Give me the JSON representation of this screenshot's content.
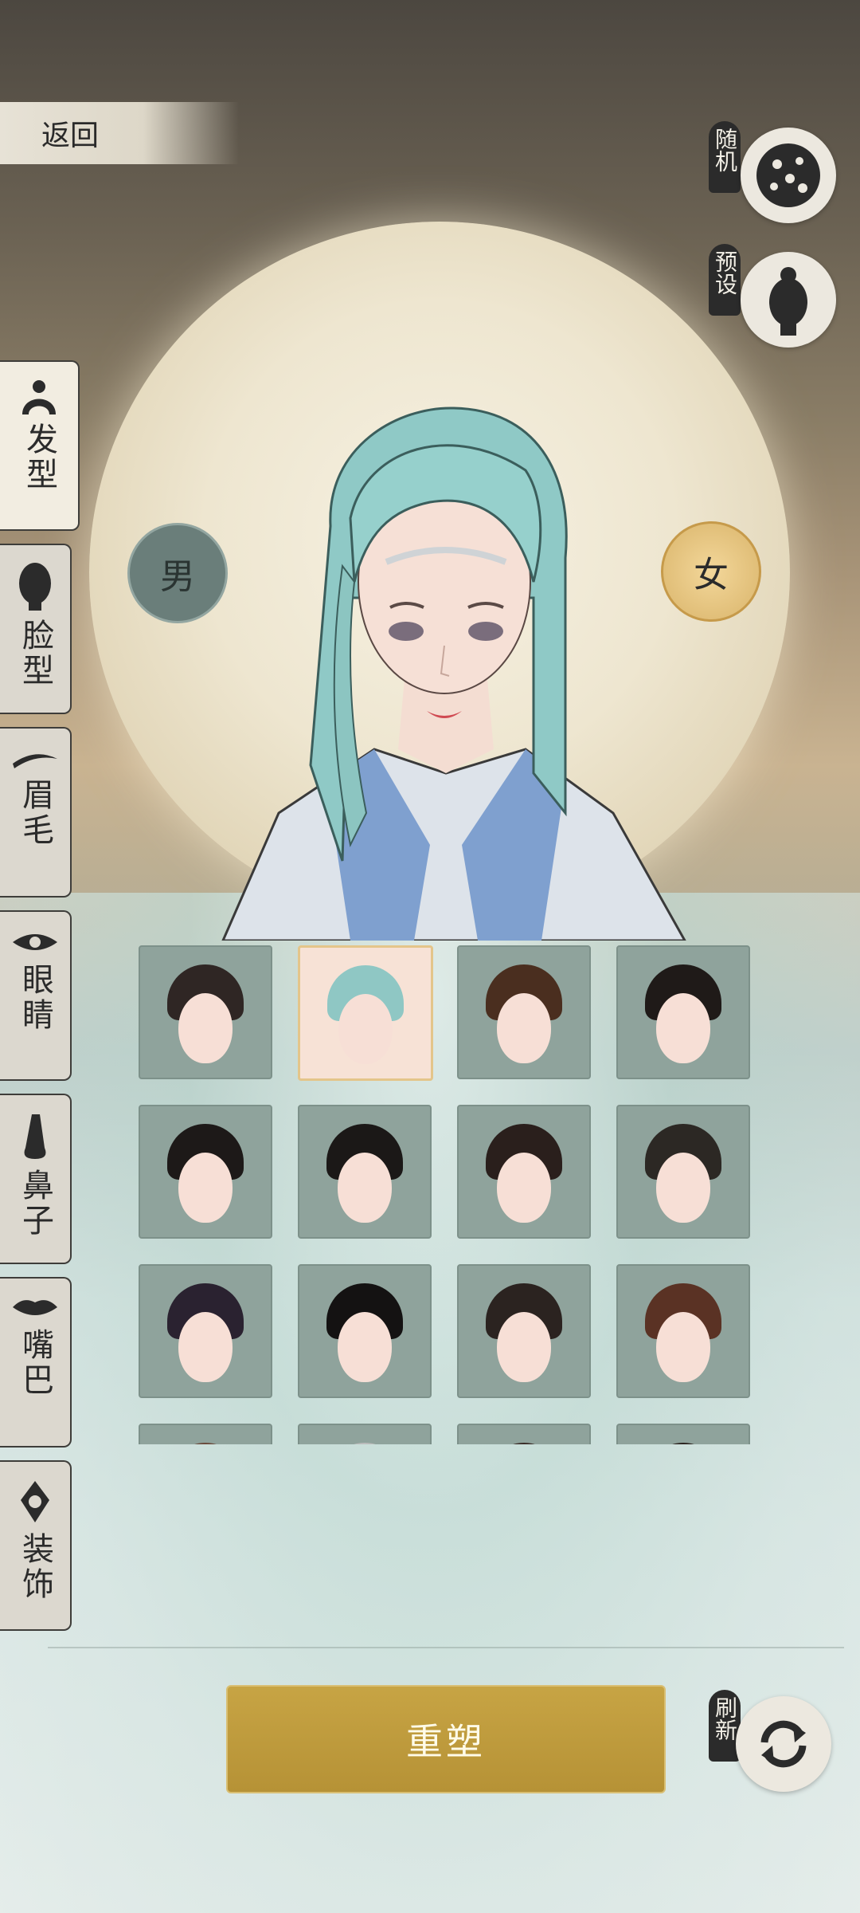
{
  "header": {
    "back_label": "返回"
  },
  "right_controls": {
    "random_label": "随机",
    "preset_label": "预设",
    "refresh_label": "刷新"
  },
  "gender": {
    "male": "男",
    "female": "女",
    "selected": "female"
  },
  "tabs": [
    {
      "id": "hair",
      "label": "发型",
      "icon": "hair-bun-icon",
      "active": true
    },
    {
      "id": "face",
      "label": "脸型",
      "icon": "head-silhouette-icon",
      "active": false
    },
    {
      "id": "brow",
      "label": "眉毛",
      "icon": "eyebrow-icon",
      "active": false
    },
    {
      "id": "eyes",
      "label": "眼睛",
      "icon": "eye-icon",
      "active": false
    },
    {
      "id": "nose",
      "label": "鼻子",
      "icon": "nose-icon",
      "active": false
    },
    {
      "id": "mouth",
      "label": "嘴巴",
      "icon": "lips-icon",
      "active": false
    },
    {
      "id": "decor",
      "label": "装饰",
      "icon": "ornament-icon",
      "active": false
    }
  ],
  "hairstyles": {
    "selected_index": 1,
    "items": [
      {
        "hair_color": "#2f2624"
      },
      {
        "hair_color": "#8fc7c4"
      },
      {
        "hair_color": "#4a2e1f"
      },
      {
        "hair_color": "#1f1a18"
      },
      {
        "hair_color": "#1d1918"
      },
      {
        "hair_color": "#1b1817"
      },
      {
        "hair_color": "#2a1f1c"
      },
      {
        "hair_color": "#2c2824"
      },
      {
        "hair_color": "#2a2230"
      },
      {
        "hair_color": "#141212"
      },
      {
        "hair_color": "#2b2320"
      },
      {
        "hair_color": "#5a3224"
      },
      {
        "hair_color": "#6a4a3c"
      },
      {
        "hair_color": "#bcbcbc"
      },
      {
        "hair_color": "#3a2c28"
      },
      {
        "hair_color": "#2c2420"
      }
    ]
  },
  "action": {
    "remold_label": "重塑"
  },
  "colors": {
    "accent_gold": "#c2a040",
    "tab_bg": "#dcd8cf",
    "moon": "#efe7d2"
  }
}
